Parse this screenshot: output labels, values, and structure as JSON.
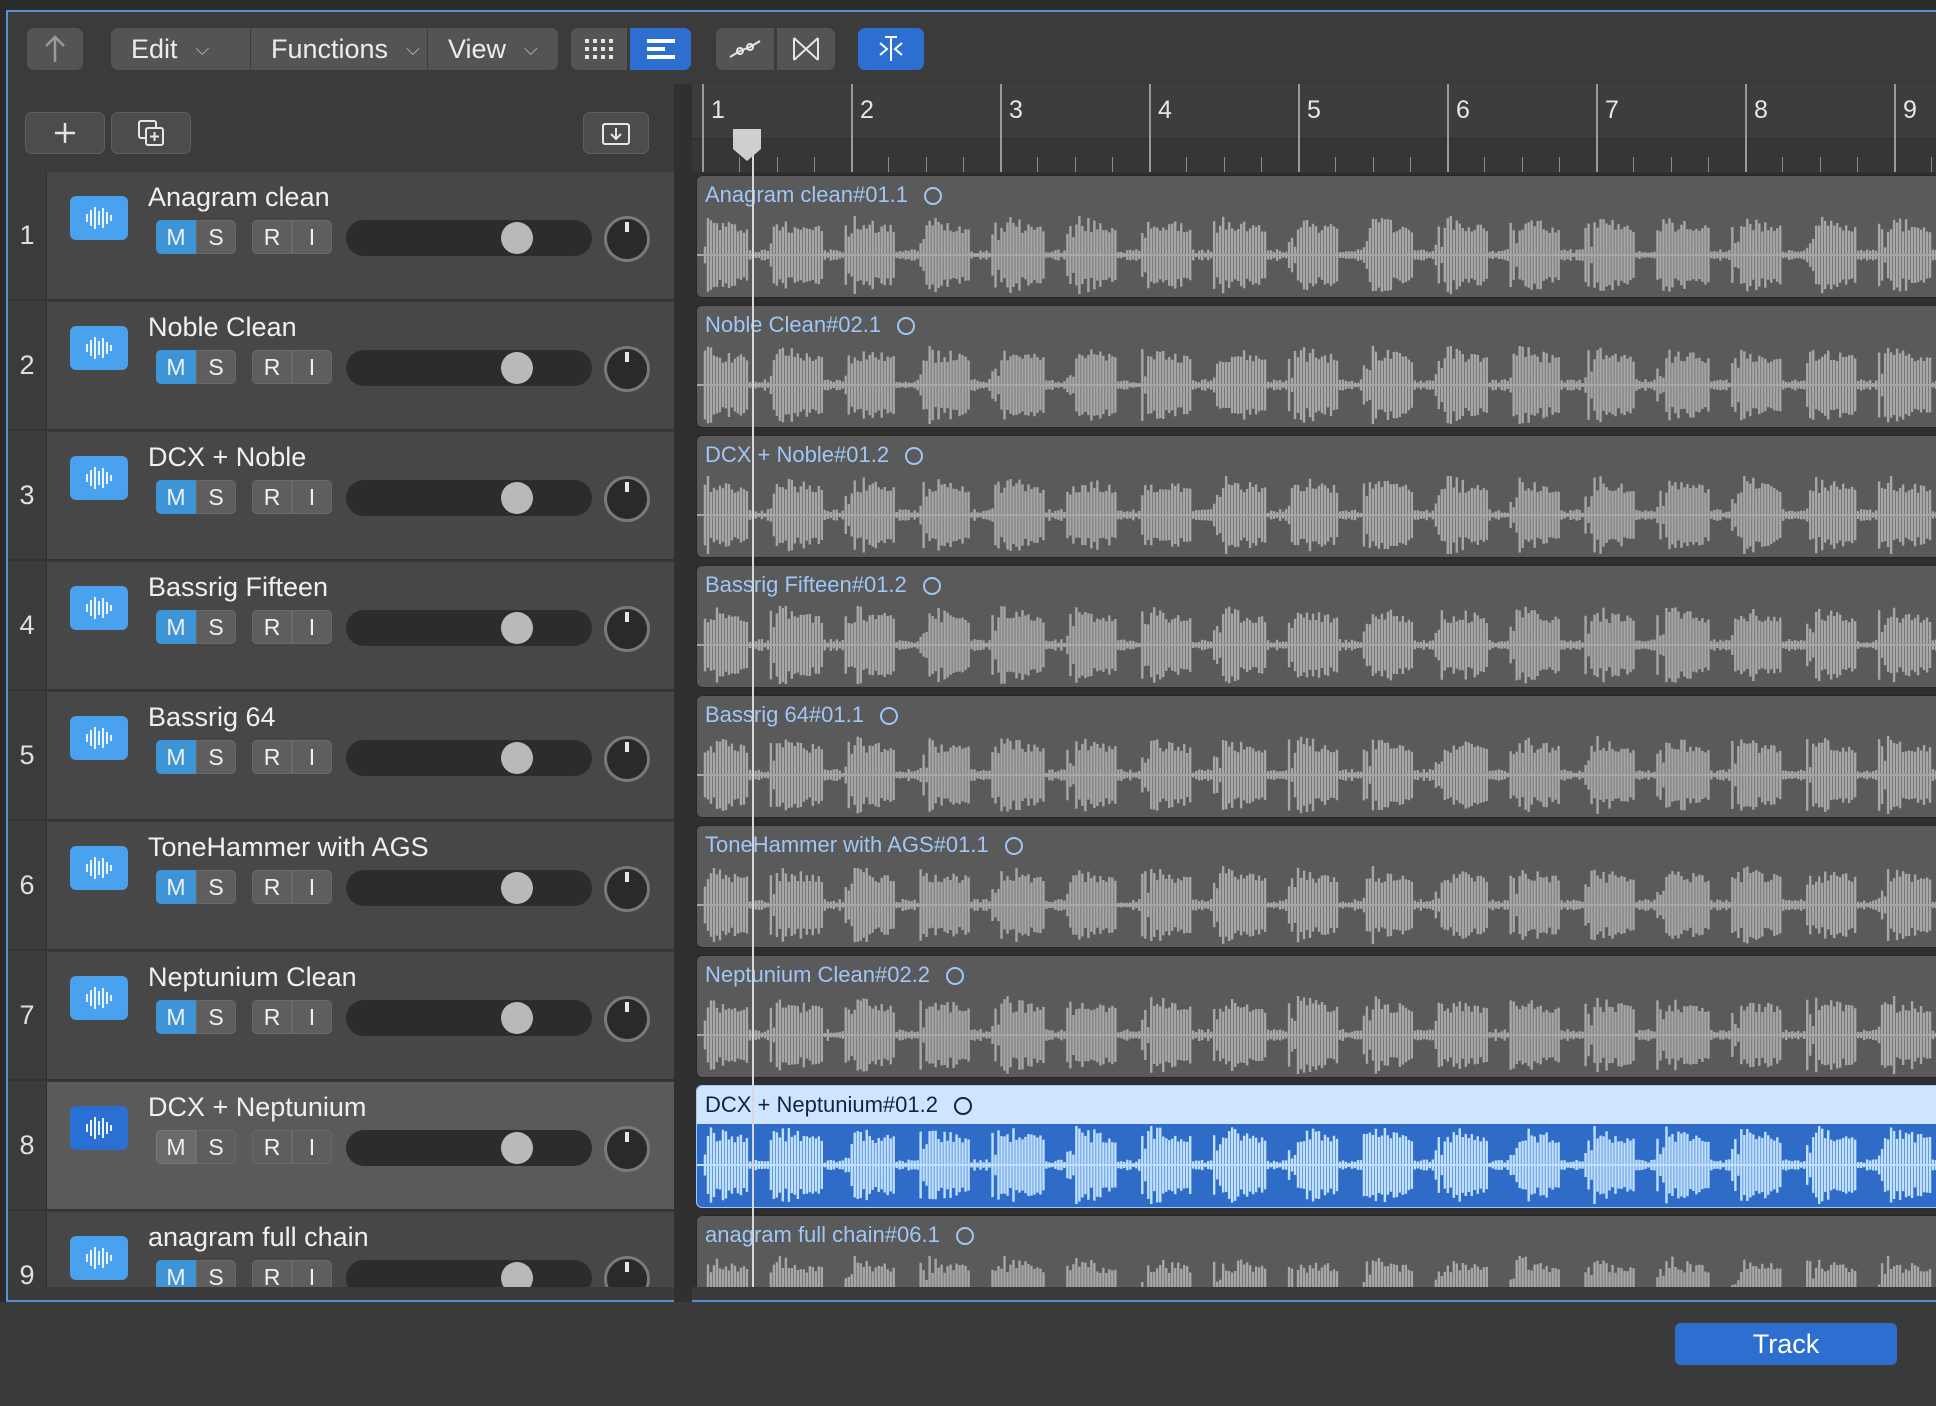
{
  "toolbar": {
    "menus": [
      {
        "label": "Edit"
      },
      {
        "label": "Functions"
      },
      {
        "label": "View"
      }
    ]
  },
  "ruler": {
    "bars": [
      "1",
      "2",
      "3",
      "4",
      "5",
      "6",
      "7",
      "8",
      "9"
    ]
  },
  "tracks": [
    {
      "number": "1",
      "name": "Anagram clean",
      "region": "Anagram clean#01.1",
      "selected": false
    },
    {
      "number": "2",
      "name": "Noble Clean",
      "region": "Noble Clean#02.1",
      "selected": false
    },
    {
      "number": "3",
      "name": "DCX + Noble",
      "region": "DCX + Noble#01.2",
      "selected": false
    },
    {
      "number": "4",
      "name": "Bassrig Fifteen",
      "region": "Bassrig Fifteen#01.2",
      "selected": false
    },
    {
      "number": "5",
      "name": "Bassrig 64",
      "region": "Bassrig 64#01.1",
      "selected": false
    },
    {
      "number": "6",
      "name": "ToneHammer with AGS",
      "region": "ToneHammer with AGS#01.1",
      "selected": false
    },
    {
      "number": "7",
      "name": "Neptunium Clean",
      "region": "Neptunium Clean#02.2",
      "selected": false
    },
    {
      "number": "8",
      "name": "DCX + Neptunium",
      "region": "DCX + Neptunium#01.2",
      "selected": true
    },
    {
      "number": "9",
      "name": "anagram full chain",
      "region": "anagram full chain#06.1",
      "selected": false
    }
  ],
  "buttons": {
    "mute": "M",
    "solo": "S",
    "record": "R",
    "input": "I"
  },
  "bottom": {
    "track_button": "Track"
  },
  "colors": {
    "accent": "#2c6fd0",
    "track_icon": "#4aa2ee",
    "mute_active": "#3d95d8"
  }
}
